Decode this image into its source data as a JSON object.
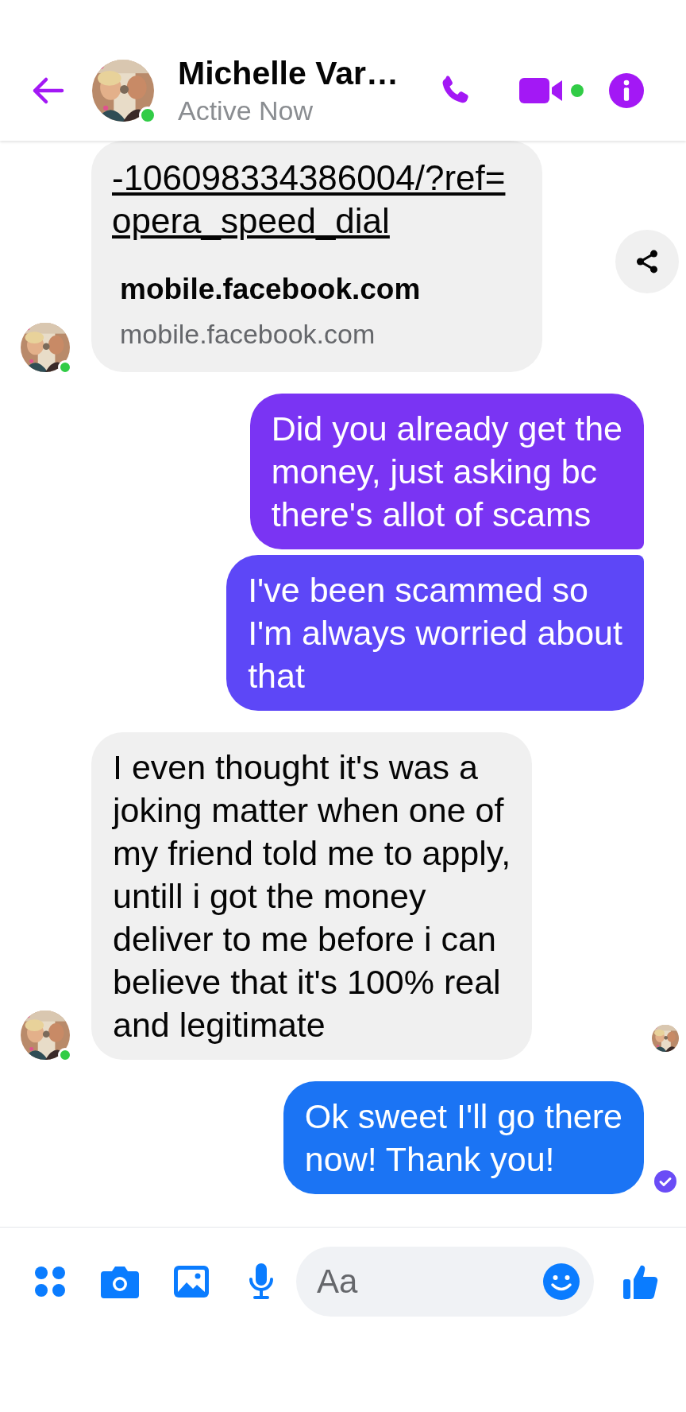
{
  "header": {
    "title": "Michelle Var…",
    "status": "Active Now",
    "online": true,
    "video_online": true
  },
  "messages": [
    {
      "kind": "link",
      "outgoing": false,
      "url_lines": [
        "-106098334386004/?ref=",
        "opera_speed_dial"
      ],
      "title": "mobile.facebook.com",
      "domain": "mobile.facebook.com",
      "avatar": true,
      "online": true,
      "share": true
    },
    {
      "kind": "text",
      "outgoing": true,
      "lines": [
        "Did you already get the",
        "money, just asking bc",
        "there's allot of scams"
      ],
      "color": "#7a34f3"
    },
    {
      "kind": "text",
      "outgoing": true,
      "lines": [
        "I've been scammed so",
        "I'm always worried about",
        "that"
      ],
      "color": "#5d47f7"
    },
    {
      "kind": "text",
      "outgoing": false,
      "lines": [
        "I even thought it's was a",
        "joking matter when one of",
        "my friend told me to apply,",
        "untill i got the money",
        "deliver to me before i can",
        "believe that it's 100% real",
        "and legitimate"
      ],
      "avatar": true,
      "online": true,
      "seen": true
    },
    {
      "kind": "text",
      "outgoing": true,
      "lines": [
        "Ok sweet I'll go there",
        "now! Thank you!"
      ],
      "color": "#1b74f4",
      "delivered": true
    }
  ],
  "composer": {
    "placeholder": "Aa"
  }
}
